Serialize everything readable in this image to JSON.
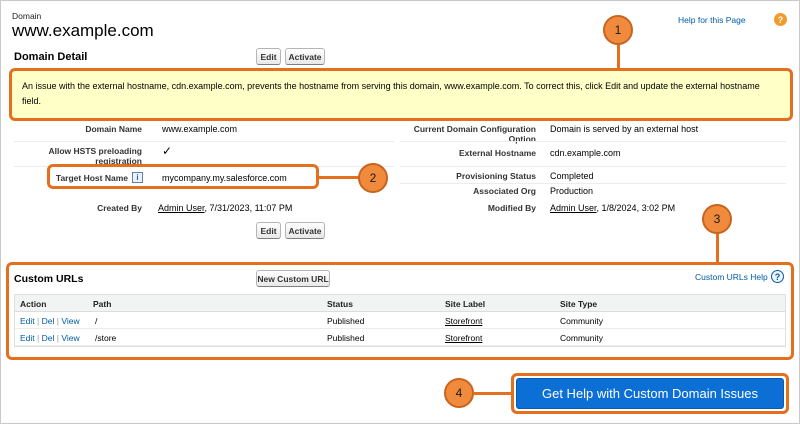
{
  "header": {
    "breadcrumb": "Domain",
    "title": "www.example.com",
    "help_link": "Help for this Page",
    "help_icon": "?"
  },
  "domain_detail": {
    "section_title": "Domain Detail",
    "edit_label": "Edit",
    "activate_label": "Activate",
    "warning": "An issue with the external hostname, cdn.example.com, prevents the hostname from serving this domain, www.example.com. To correct this, click Edit and update the external hostname field.",
    "fields": {
      "domain_name_label": "Domain Name",
      "domain_name_value": "www.example.com",
      "hsts_label": "Allow HSTS preloading registration",
      "hsts_value": "✓",
      "target_host_label": "Target Host Name",
      "target_host_info": "i",
      "target_host_value": "mycompany.my.salesforce.com",
      "created_by_label": "Created By",
      "created_by_user": "Admin User",
      "created_by_date": ", 7/31/2023, 11:07 PM",
      "config_option_label": "Current Domain Configuration Option",
      "config_option_value": "Domain is served by an external host",
      "external_host_label": "External Hostname",
      "external_host_value": "cdn.example.com",
      "provisioning_label": "Provisioning Status",
      "provisioning_value": "Completed",
      "associated_org_label": "Associated Org",
      "associated_org_value": "Production",
      "modified_by_label": "Modified By",
      "modified_by_user": "Admin User",
      "modified_by_date": ", 1/8/2024, 3:02 PM"
    }
  },
  "custom_urls": {
    "section_title": "Custom URLs",
    "new_button": "New Custom URL",
    "help_link": "Custom URLs Help",
    "help_icon": "?",
    "columns": [
      "Action",
      "Path",
      "Status",
      "Site Label",
      "Site Type"
    ],
    "rows": [
      {
        "edit": "Edit",
        "del": "Del",
        "view": "View",
        "sep": "|",
        "path": "/",
        "status": "Published",
        "site_label": "Storefront",
        "site_type": "Community"
      },
      {
        "edit": "Edit",
        "del": "Del",
        "view": "View",
        "sep": "|",
        "path": "/store",
        "status": "Published",
        "site_label": "Storefront",
        "site_type": "Community"
      }
    ]
  },
  "cta": {
    "label": "Get Help with Custom Domain Issues"
  },
  "callouts": [
    "1",
    "2",
    "3",
    "4"
  ],
  "colors": {
    "callout": "#e46f1f",
    "callout_fill": "#f08a3c",
    "warning_bg": "#ffffc8",
    "cta_bg": "#0b6fd6",
    "link": "#015ba7"
  }
}
